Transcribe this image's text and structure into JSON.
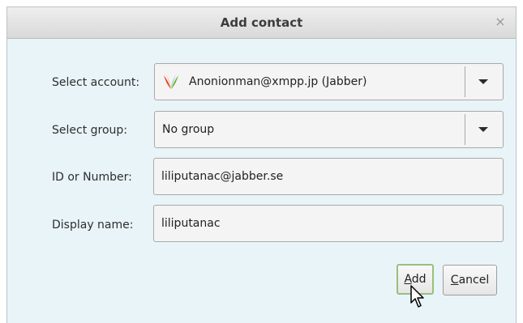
{
  "window": {
    "title": "Add contact",
    "close_symbol": "×"
  },
  "form": {
    "account": {
      "label": "Select account:",
      "value": "Anonionman@xmpp.jp (Jabber)",
      "icon": "jabber-logo-icon"
    },
    "group": {
      "label": "Select group:",
      "value": "No group"
    },
    "id": {
      "label": "ID or Number:",
      "value": "liliputanac@jabber.se"
    },
    "display_name": {
      "label": "Display name:",
      "value": "liliputanac"
    }
  },
  "buttons": {
    "add": {
      "mnemonic": "A",
      "rest": "dd"
    },
    "cancel": {
      "mnemonic": "C",
      "rest": "ancel"
    }
  },
  "colors": {
    "dialog_background": "#e8f4f8",
    "focus_ring": "#98c07b"
  }
}
